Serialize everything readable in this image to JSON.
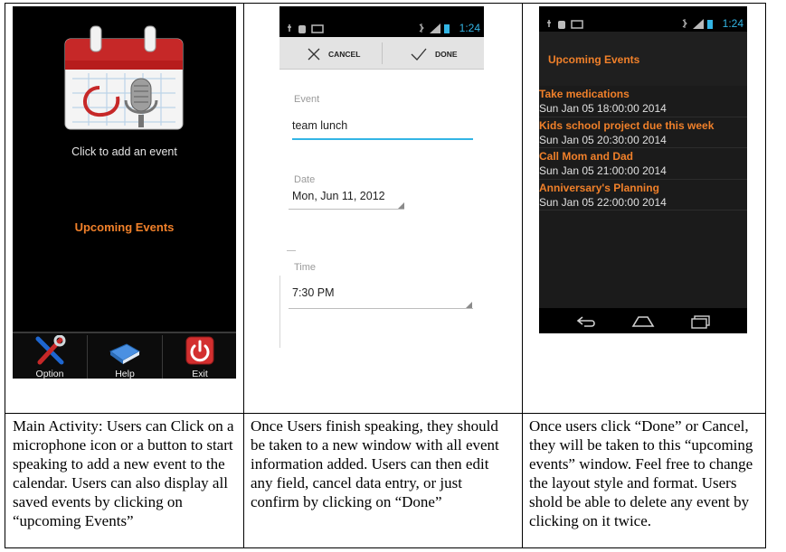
{
  "screen1": {
    "click_text": "Click to add an event",
    "upcoming_label": "Upcoming Events",
    "buttons": [
      {
        "label": "Option",
        "icon": "tools-icon"
      },
      {
        "label": "Help",
        "icon": "book-icon"
      },
      {
        "label": "Exit",
        "icon": "power-icon"
      }
    ]
  },
  "screen2": {
    "status_time": "1:24",
    "cancel_label": "CANCEL",
    "done_label": "DONE",
    "event_label": "Event",
    "event_value": "team lunch",
    "date_label": "Date",
    "date_value": "Mon, Jun 11, 2012",
    "time_label": "Time",
    "time_value": "7:30 PM"
  },
  "screen3": {
    "status_time": "1:24",
    "header_title": "Upcoming Events",
    "events": [
      {
        "title": "Take medications",
        "date": "Sun Jan 05 18:00:00 2014"
      },
      {
        "title": "Kids school project due this week",
        "date": "Sun Jan 05 20:30:00 2014"
      },
      {
        "title": "Call Mom and Dad",
        "date": "Sun Jan 05 21:00:00 2014"
      },
      {
        "title": "Anniversary's Planning",
        "date": "Sun Jan 05 22:00:00 2014"
      }
    ]
  },
  "captions": {
    "col1": "Main Activity: Users can Click on a microphone icon or a button to start speaking to add a new event to the calendar. Users can also display all saved events by clicking on “upcoming Events”",
    "col2": "Once Users finish speaking, they should be taken to a new window with all event information added. Users can then edit any field, cancel data entry, or just confirm by clicking on “Done”",
    "col3": "Once users click “Done” or Cancel, they will be taken to this “upcoming events” window. Feel free to change the layout style and format. Users shold be able to delete any event by clicking on it twice."
  },
  "colors": {
    "accent_orange": "#f0802a",
    "holo_blue": "#33b5e5",
    "calendar_red": "#c62828"
  }
}
